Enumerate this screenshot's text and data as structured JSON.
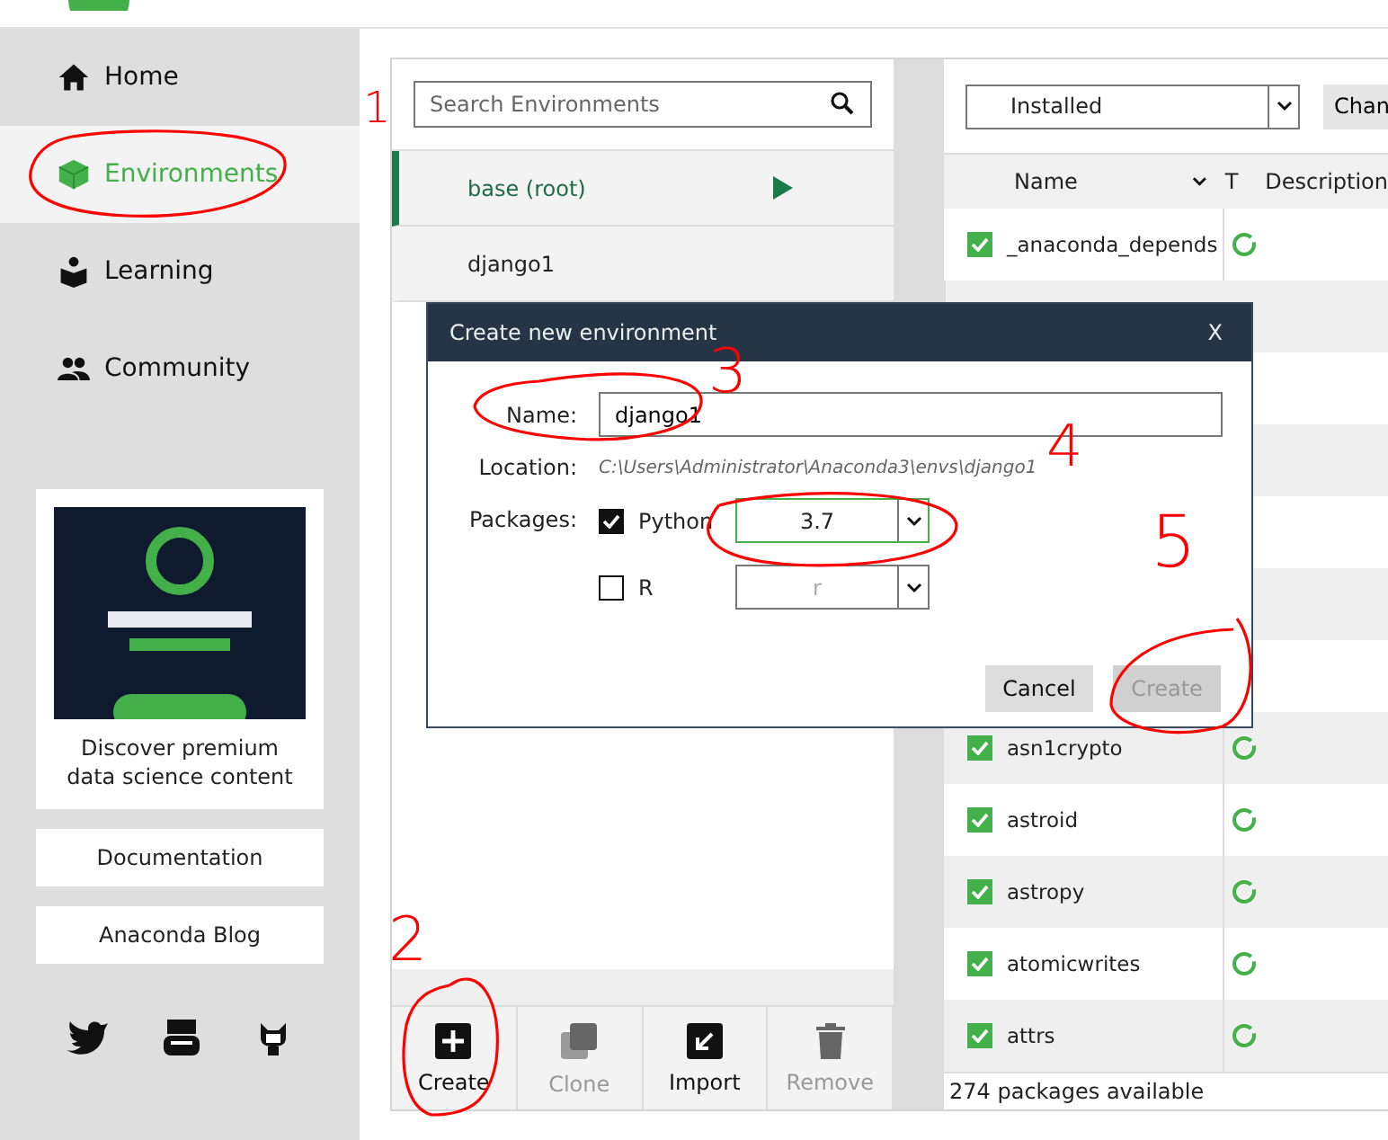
{
  "sidebar": {
    "items": [
      {
        "label": "Home",
        "selected": false
      },
      {
        "label": "Environments",
        "selected": true
      },
      {
        "label": "Learning",
        "selected": false
      },
      {
        "label": "Community",
        "selected": false
      }
    ],
    "promo": {
      "caption": "Discover premium data science content"
    },
    "links": [
      "Documentation",
      "Anaconda Blog"
    ]
  },
  "environments": {
    "search": {
      "placeholder": "Search Environments"
    },
    "items": [
      {
        "name": "base (root)",
        "selected": true
      },
      {
        "name": "django1",
        "selected": false
      }
    ],
    "actions": [
      {
        "label": "Create",
        "disabled": false
      },
      {
        "label": "Clone",
        "disabled": true
      },
      {
        "label": "Import",
        "disabled": false
      },
      {
        "label": "Remove",
        "disabled": true
      }
    ]
  },
  "packages": {
    "filter": "Installed",
    "channels_button": "Chan",
    "columns": [
      "Name",
      "T",
      "Description"
    ],
    "rows": [
      {
        "name": "_anaconda_depends",
        "checked": true
      },
      {
        "name": "asn1crypto",
        "checked": true
      },
      {
        "name": "astroid",
        "checked": true
      },
      {
        "name": "astropy",
        "checked": true
      },
      {
        "name": "atomicwrites",
        "checked": true
      },
      {
        "name": "attrs",
        "checked": true
      }
    ],
    "status": "274 packages available"
  },
  "dialog": {
    "title": "Create new environment",
    "close": "X",
    "name_label": "Name:",
    "name_value": "django1",
    "location_label": "Location:",
    "location": "C:\\Users\\Administrator\\Anaconda3\\envs\\django1",
    "packages_label": "Packages:",
    "packages": [
      {
        "name": "Python",
        "checked": true,
        "version": "3.7"
      },
      {
        "name": "R",
        "checked": false,
        "version": "r"
      }
    ],
    "buttons": [
      {
        "label": "Cancel",
        "disabled": false
      },
      {
        "label": "Create",
        "disabled": true
      }
    ]
  },
  "annotations": [
    "1",
    "2",
    "3",
    "4",
    "5"
  ]
}
